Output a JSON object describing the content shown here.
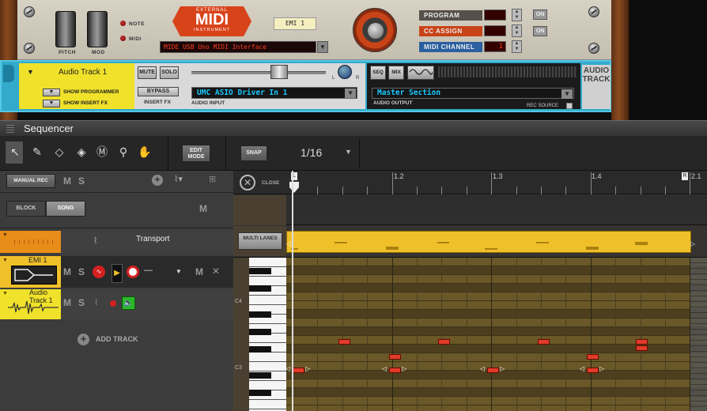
{
  "rack": {
    "emi": {
      "pitch_label": "PITCH",
      "mod_label": "MOD",
      "note_label": "NOTE",
      "midi_label": "MIDI",
      "logo_top": "EXTERNAL",
      "logo_main": "MIDI",
      "logo_bottom": "INSTRUMENT",
      "device_name": "EMI 1",
      "midi_interface": "MIDE USB Uno MIDI Interface",
      "program_label": "PROGRAM",
      "cc_assign_label": "CC ASSIGN",
      "midi_channel_label": "MIDI CHANNEL",
      "midi_channel_value": "1",
      "on_label": "ON"
    },
    "audio_track": {
      "name": "Audio Track 1",
      "show_programmer": "SHOW PROGRAMMER",
      "show_insert_fx": "SHOW INSERT FX",
      "mute": "MUTE",
      "solo": "SOLO",
      "bypass": "BYPASS",
      "insert_fx": "INSERT FX",
      "audio_input_label": "AUDIO INPUT",
      "audio_input_value": "UMC ASIO Driver In 1",
      "l_label": "L",
      "r_label": "R",
      "seq": "SEQ",
      "mix": "MIX",
      "audio_output_label": "AUDIO OUTPUT",
      "audio_output_value": "Master Section",
      "rec_source": "REC SOURCE",
      "type_label_1": "AUDIO",
      "type_label_2": "TRACK"
    }
  },
  "sequencer": {
    "title": "Sequencer",
    "edit_mode": "EDIT MODE",
    "snap": "SNAP",
    "snap_value": "1/16",
    "manual_rec": "MANUAL REC",
    "m": "M",
    "s": "S",
    "block": "BLOCK",
    "song": "SONG",
    "close": "CLOSE",
    "multi_lanes": "MULTI LANES",
    "add_track": "ADD TRACK",
    "tracks": [
      {
        "name": "Transport"
      },
      {
        "name": "EMI 1",
        "dash": "—"
      },
      {
        "name": "Audio Track 1"
      }
    ],
    "ruler": [
      "1",
      "1.2",
      "1.3",
      "1.4",
      "2.1"
    ],
    "loop_left": "L",
    "loop_right": "R",
    "key_labels": [
      "C4",
      "C3"
    ],
    "colors": {
      "accent": "#f0c02a",
      "audio_track_blue": "#33aacc",
      "emi_red": "#d8431a",
      "note_red": "#e03c2a"
    }
  }
}
